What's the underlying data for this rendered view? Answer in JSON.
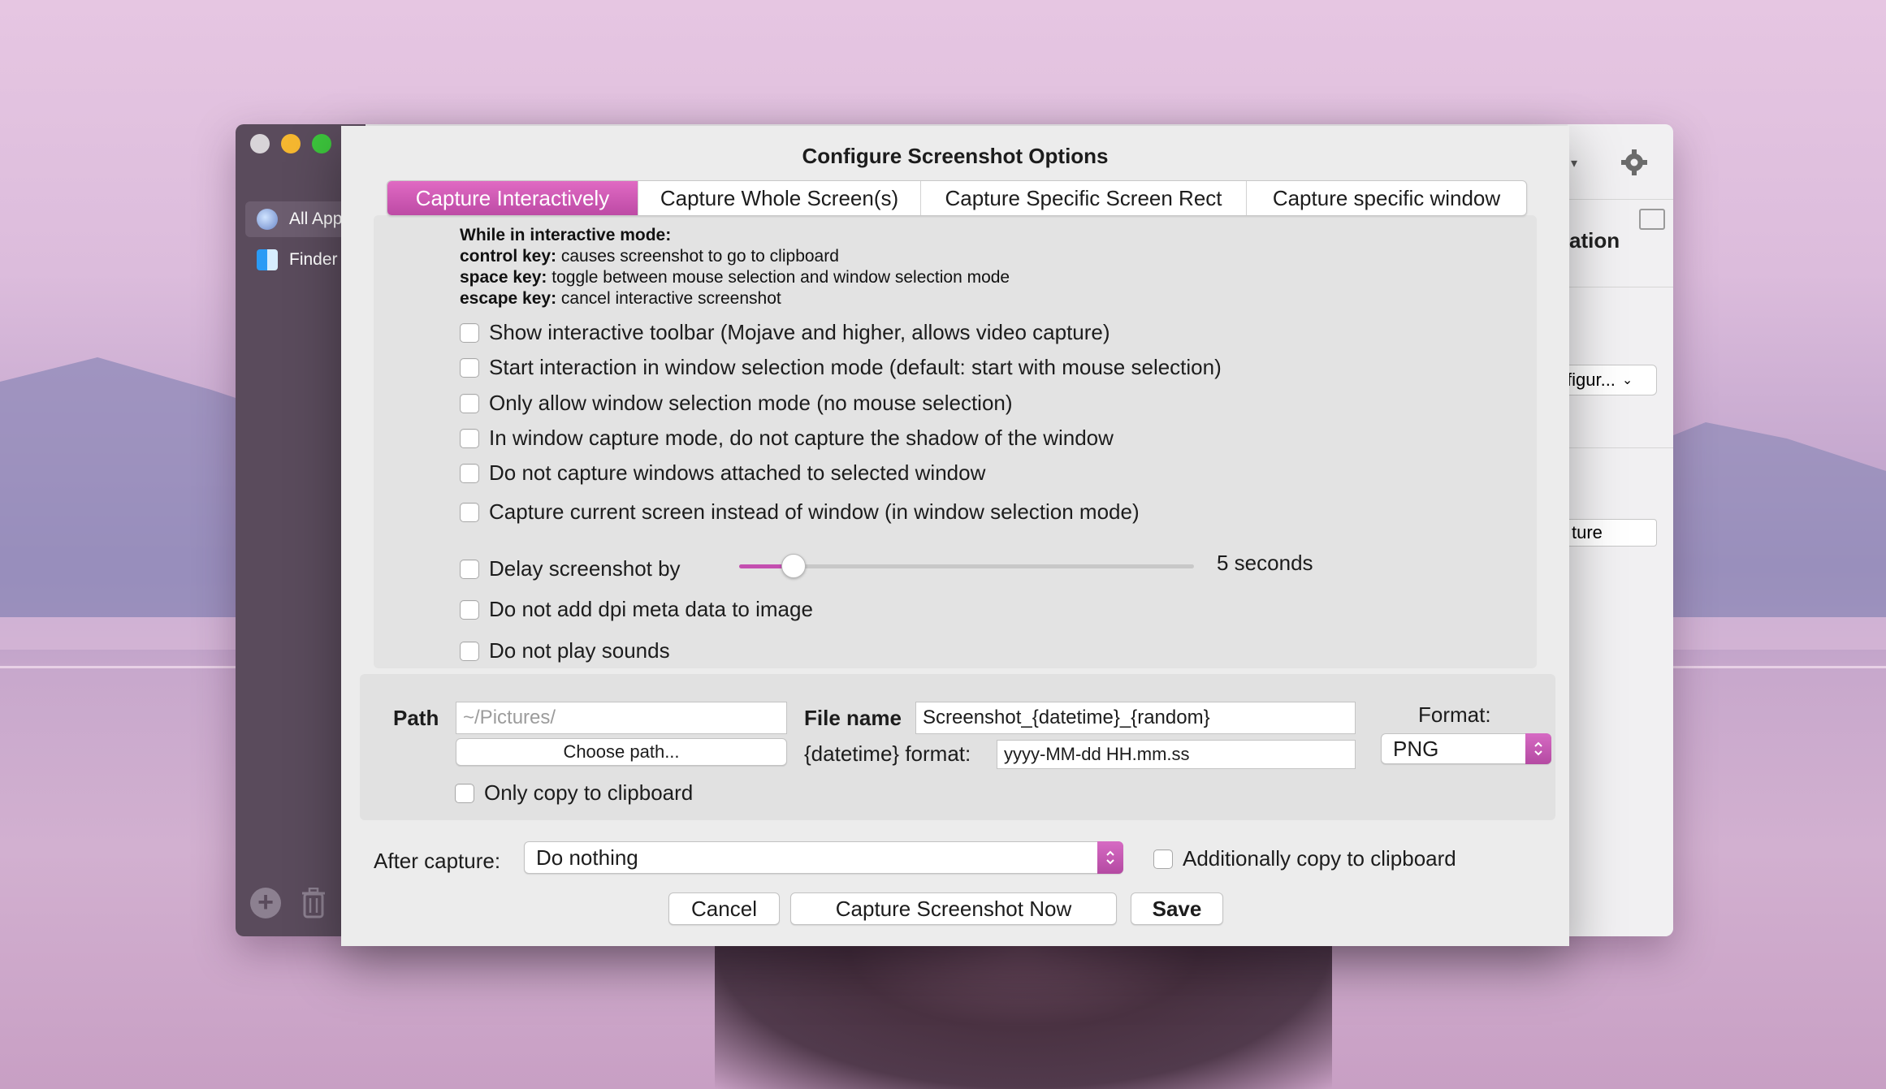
{
  "background_window": {
    "sidebar": [
      {
        "label": "All App",
        "icon": "globe-icon"
      },
      {
        "label": "Finder",
        "icon": "finder-icon"
      }
    ],
    "right_fragments": {
      "heading": "ation",
      "popup": "figur...",
      "field": "ture"
    }
  },
  "dialog": {
    "title": "Configure Screenshot Options",
    "tabs": [
      "Capture Interactively",
      "Capture Whole Screen(s)",
      "Capture Specific Screen Rect",
      "Capture specific window"
    ],
    "active_tab": 0,
    "info": {
      "heading": "While in interactive mode:",
      "lines": [
        {
          "key": "control key:",
          "text": " causes screenshot to go to clipboard"
        },
        {
          "key": "space key:",
          "text": " toggle between mouse selection and window selection mode"
        },
        {
          "key": "escape key:",
          "text": " cancel interactive screenshot"
        }
      ]
    },
    "interactive_options": [
      "Show interactive toolbar (Mojave and higher, allows video capture)",
      "Start interaction in window selection mode (default: start with mouse selection)",
      "Only allow window selection mode (no mouse selection)",
      "In window capture mode, do not capture the shadow of the window",
      "Do not capture windows attached to selected window",
      "Capture current screen instead of window (in window selection mode)"
    ],
    "delay": {
      "label": "Delay screenshot by",
      "value_label": "5 seconds",
      "slider_fraction": 0.12
    },
    "dpi_label": "Do not add dpi meta data to image",
    "sounds_label": "Do not play sounds",
    "path": {
      "label": "Path",
      "placeholder": "~/Pictures/",
      "choose_button": "Choose path...",
      "clipboard_only": "Only copy to clipboard"
    },
    "filename": {
      "label": "File name",
      "value": "Screenshot_{datetime}_{random}",
      "datetime_label": "{datetime} format:",
      "datetime_value": "yyyy-MM-dd HH.mm.ss"
    },
    "format": {
      "label": "Format:",
      "value": "PNG"
    },
    "after_capture": {
      "label": "After capture:",
      "value": "Do nothing",
      "additional": "Additionally copy to clipboard"
    },
    "buttons": {
      "cancel": "Cancel",
      "capture": "Capture Screenshot Now",
      "save": "Save"
    }
  },
  "colors": {
    "accent": "#c44fb0"
  }
}
